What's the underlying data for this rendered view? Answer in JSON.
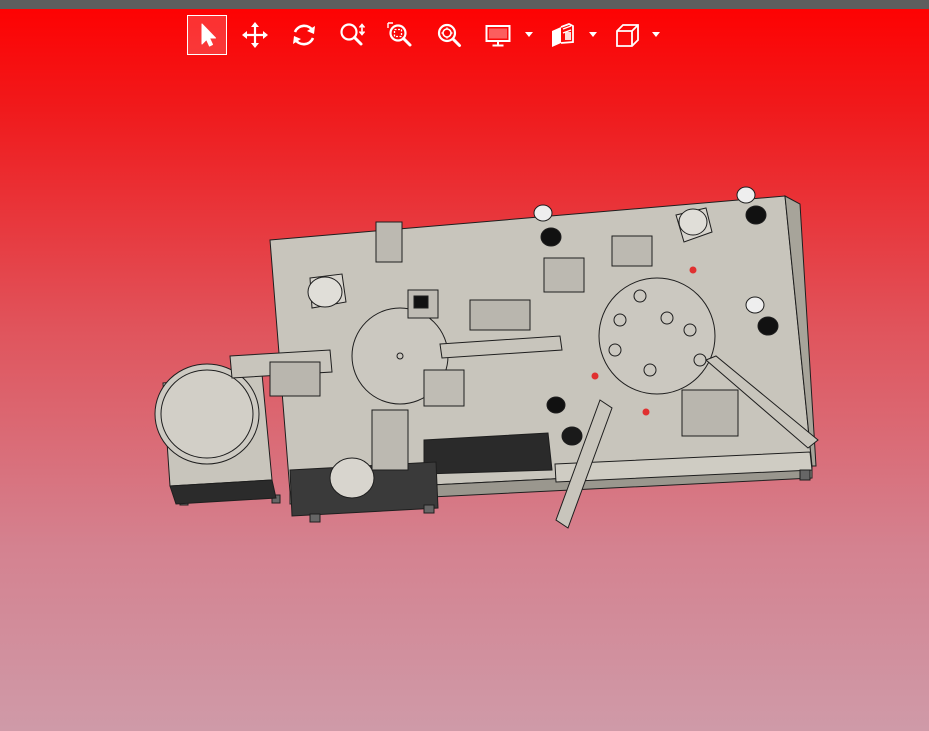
{
  "window": {
    "title_bar_color": "#5e5e5e"
  },
  "toolbar": {
    "tools": [
      {
        "id": "select",
        "icon": "select-arrow-icon",
        "active": true
      },
      {
        "id": "pan",
        "icon": "pan-move-icon",
        "active": false
      },
      {
        "id": "rotate",
        "icon": "rotate-icon",
        "active": false
      },
      {
        "id": "zoom",
        "icon": "zoom-icon",
        "active": false
      },
      {
        "id": "zoom-window",
        "icon": "zoom-window-icon",
        "active": false
      },
      {
        "id": "zoom-fit",
        "icon": "zoom-fit-icon",
        "active": false
      },
      {
        "id": "display",
        "icon": "display-monitor-icon",
        "active": false,
        "dropdown": true
      },
      {
        "id": "section",
        "icon": "section-cut-icon",
        "active": false,
        "dropdown": true
      },
      {
        "id": "view-cube",
        "icon": "view-cube-icon",
        "active": false,
        "dropdown": true
      }
    ]
  },
  "scene": {
    "background_top": "#ff0000",
    "background_bottom": "#cf9aa8",
    "model_color": "#c8c5bc",
    "model_edge_color": "#1e1e1e",
    "model": "assembly-machine-3d-model"
  }
}
